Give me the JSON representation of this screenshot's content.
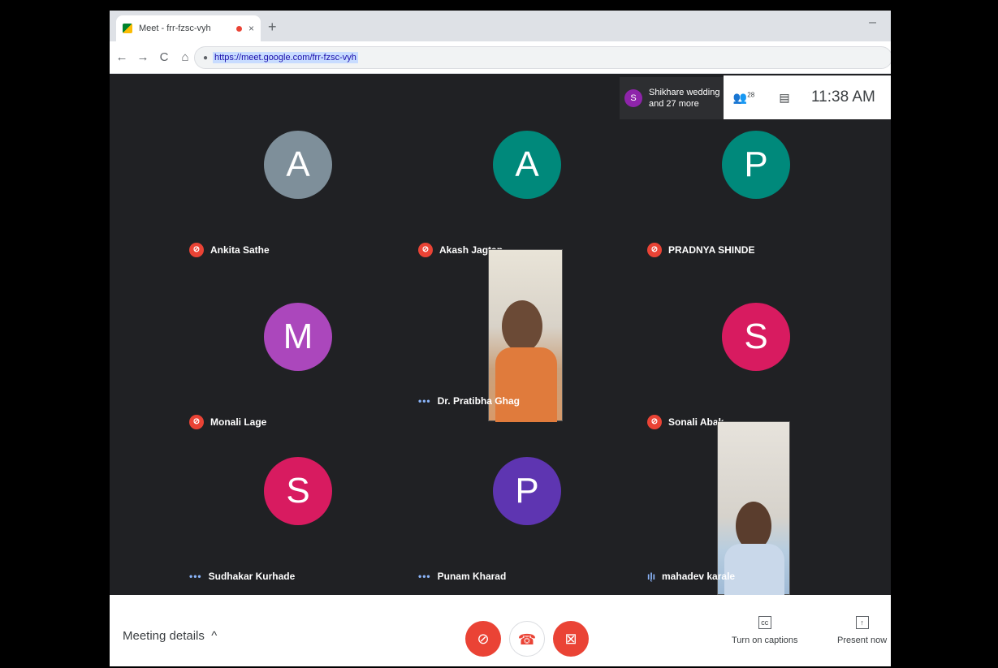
{
  "browser": {
    "tab_title": "Meet - frr-fzsc-vyh",
    "tab_close": "×",
    "new_tab": "+",
    "minimize": "–",
    "back": "←",
    "forward": "→",
    "reload": "C",
    "home": "⌂",
    "url": "https://meet.google.com/frr-fzsc-vyh"
  },
  "meet": {
    "chip_initial": "S",
    "chip_line1": "Shikhare wedding",
    "chip_line2": "and 27 more",
    "participant_count": "28",
    "time": "11:38 AM"
  },
  "tiles": [
    {
      "initial": "A",
      "name": "Ankita Sathe",
      "color": "#7e8f9a",
      "status": "muted"
    },
    {
      "initial": "A",
      "name": "Akash Jagtap",
      "color": "#00897b",
      "status": "muted"
    },
    {
      "initial": "P",
      "name": "PRADNYA SHINDE",
      "color": "#00897b",
      "status": "muted"
    },
    {
      "initial": "M",
      "name": "Monali Lage",
      "color": "#ab47bc",
      "status": "muted"
    },
    {
      "initial": "",
      "name": "Dr. Pratibha Ghag",
      "color": "",
      "status": "active"
    },
    {
      "initial": "S",
      "name": "Sonali Abak",
      "color": "#d81b60",
      "status": "muted"
    },
    {
      "initial": "S",
      "name": "Sudhakar Kurhade",
      "color": "#d81b60",
      "status": "active"
    },
    {
      "initial": "P",
      "name": "Punam Kharad",
      "color": "#5e35b1",
      "status": "active"
    },
    {
      "initial": "",
      "name": "mahadev karale",
      "color": "",
      "status": "speaking"
    }
  ],
  "bottom": {
    "meeting_details": "Meeting details",
    "captions": "Turn on captions",
    "present": "Present now"
  }
}
